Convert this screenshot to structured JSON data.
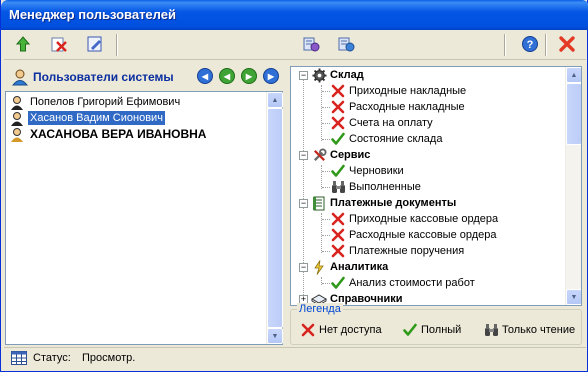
{
  "window": {
    "title": "Менеджер пользователей"
  },
  "toolbar": {
    "icons": [
      "add-user-icon",
      "delete-user-icon",
      "edit-user-icon",
      "copy-rights-icon",
      "user-rights-icon",
      "help-icon",
      "close-icon"
    ]
  },
  "users_panel": {
    "header": "Пользователи системы",
    "users": [
      {
        "name": "Попелов Григорий Ефимович",
        "selected": false,
        "bold": false
      },
      {
        "name": "Хасанов Вадим Сионович",
        "selected": true,
        "bold": false
      },
      {
        "name": "ХАСАНОВА ВЕРА ИВАНОВНА",
        "selected": false,
        "bold": true
      }
    ]
  },
  "tree": {
    "categories": [
      {
        "label": "Склад",
        "icon": "gear-icon",
        "items": [
          {
            "label": "Приходные накладные",
            "access": "none"
          },
          {
            "label": "Расходные накладные",
            "access": "none"
          },
          {
            "label": "Счета на оплату",
            "access": "none"
          },
          {
            "label": "Состояние склада",
            "access": "full"
          }
        ]
      },
      {
        "label": "Сервис",
        "icon": "tools-icon",
        "items": [
          {
            "label": "Черновики",
            "access": "full"
          },
          {
            "label": "Выполненные",
            "access": "readonly"
          }
        ]
      },
      {
        "label": "Платежные документы",
        "icon": "document-icon",
        "items": [
          {
            "label": "Приходные кассовые ордера",
            "access": "none"
          },
          {
            "label": "Расходные кассовые ордера",
            "access": "none"
          },
          {
            "label": "Платежные поручения",
            "access": "none"
          }
        ]
      },
      {
        "label": "Аналитика",
        "icon": "lightning-icon",
        "items": [
          {
            "label": "Анализ стоимости работ",
            "access": "full"
          }
        ]
      },
      {
        "label": "Справочники",
        "icon": "book-icon",
        "items": []
      }
    ]
  },
  "legend": {
    "title": "Легенда",
    "items": [
      {
        "label": "Нет доступа",
        "icon": "red-x-icon"
      },
      {
        "label": "Полный",
        "icon": "green-check-icon"
      },
      {
        "label": "Только чтение",
        "icon": "binoculars-icon"
      }
    ]
  },
  "status": {
    "label": "Статус:",
    "value": "Просмотр."
  },
  "colors": {
    "title_bar": "#0054e3",
    "selection": "#316ac5",
    "header_text": "#0b2ea0",
    "legend_title": "#0046d5",
    "no_access": "#d8231f",
    "full_access": "#2f9a1a"
  }
}
